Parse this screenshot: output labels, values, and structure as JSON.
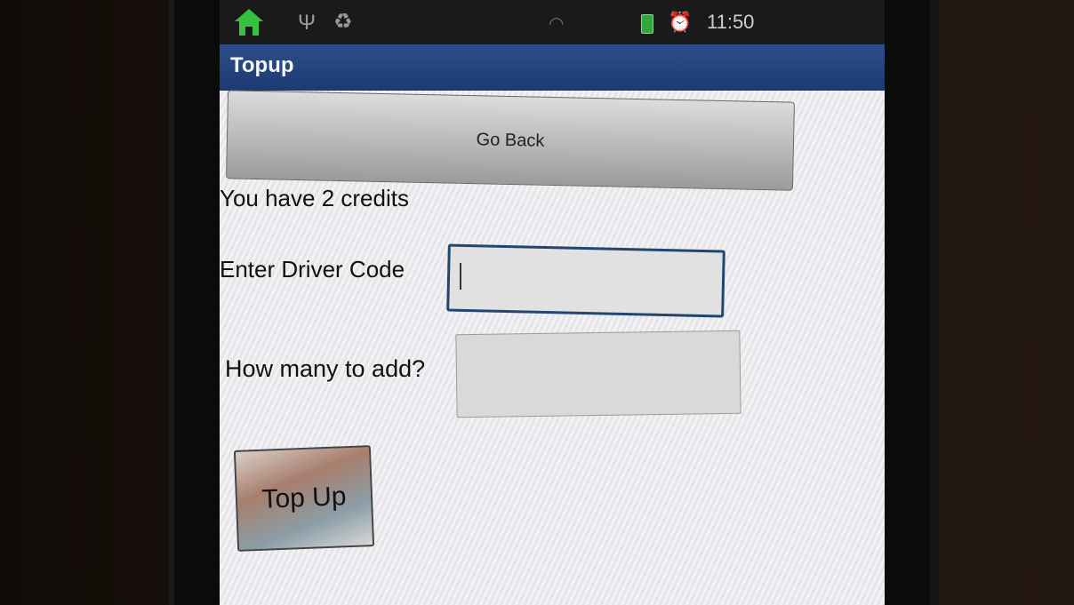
{
  "status_bar": {
    "time": "11:50",
    "icons": [
      "home-icon",
      "usb-icon",
      "recycle-icon",
      "wifi-icon",
      "battery-icon",
      "alarm-icon"
    ]
  },
  "app": {
    "title": "Topup"
  },
  "main": {
    "go_back_label": "Go Back",
    "credits_text": "You have 2 credits",
    "driver_code_label": "Enter Driver Code",
    "driver_code_value": "",
    "add_label": "How many to add?",
    "add_value": "",
    "topup_label": "Top Up"
  },
  "colors": {
    "titlebar": "#1c3a72",
    "input_border_focused": "#21476e",
    "home_icon": "#36c23f"
  }
}
